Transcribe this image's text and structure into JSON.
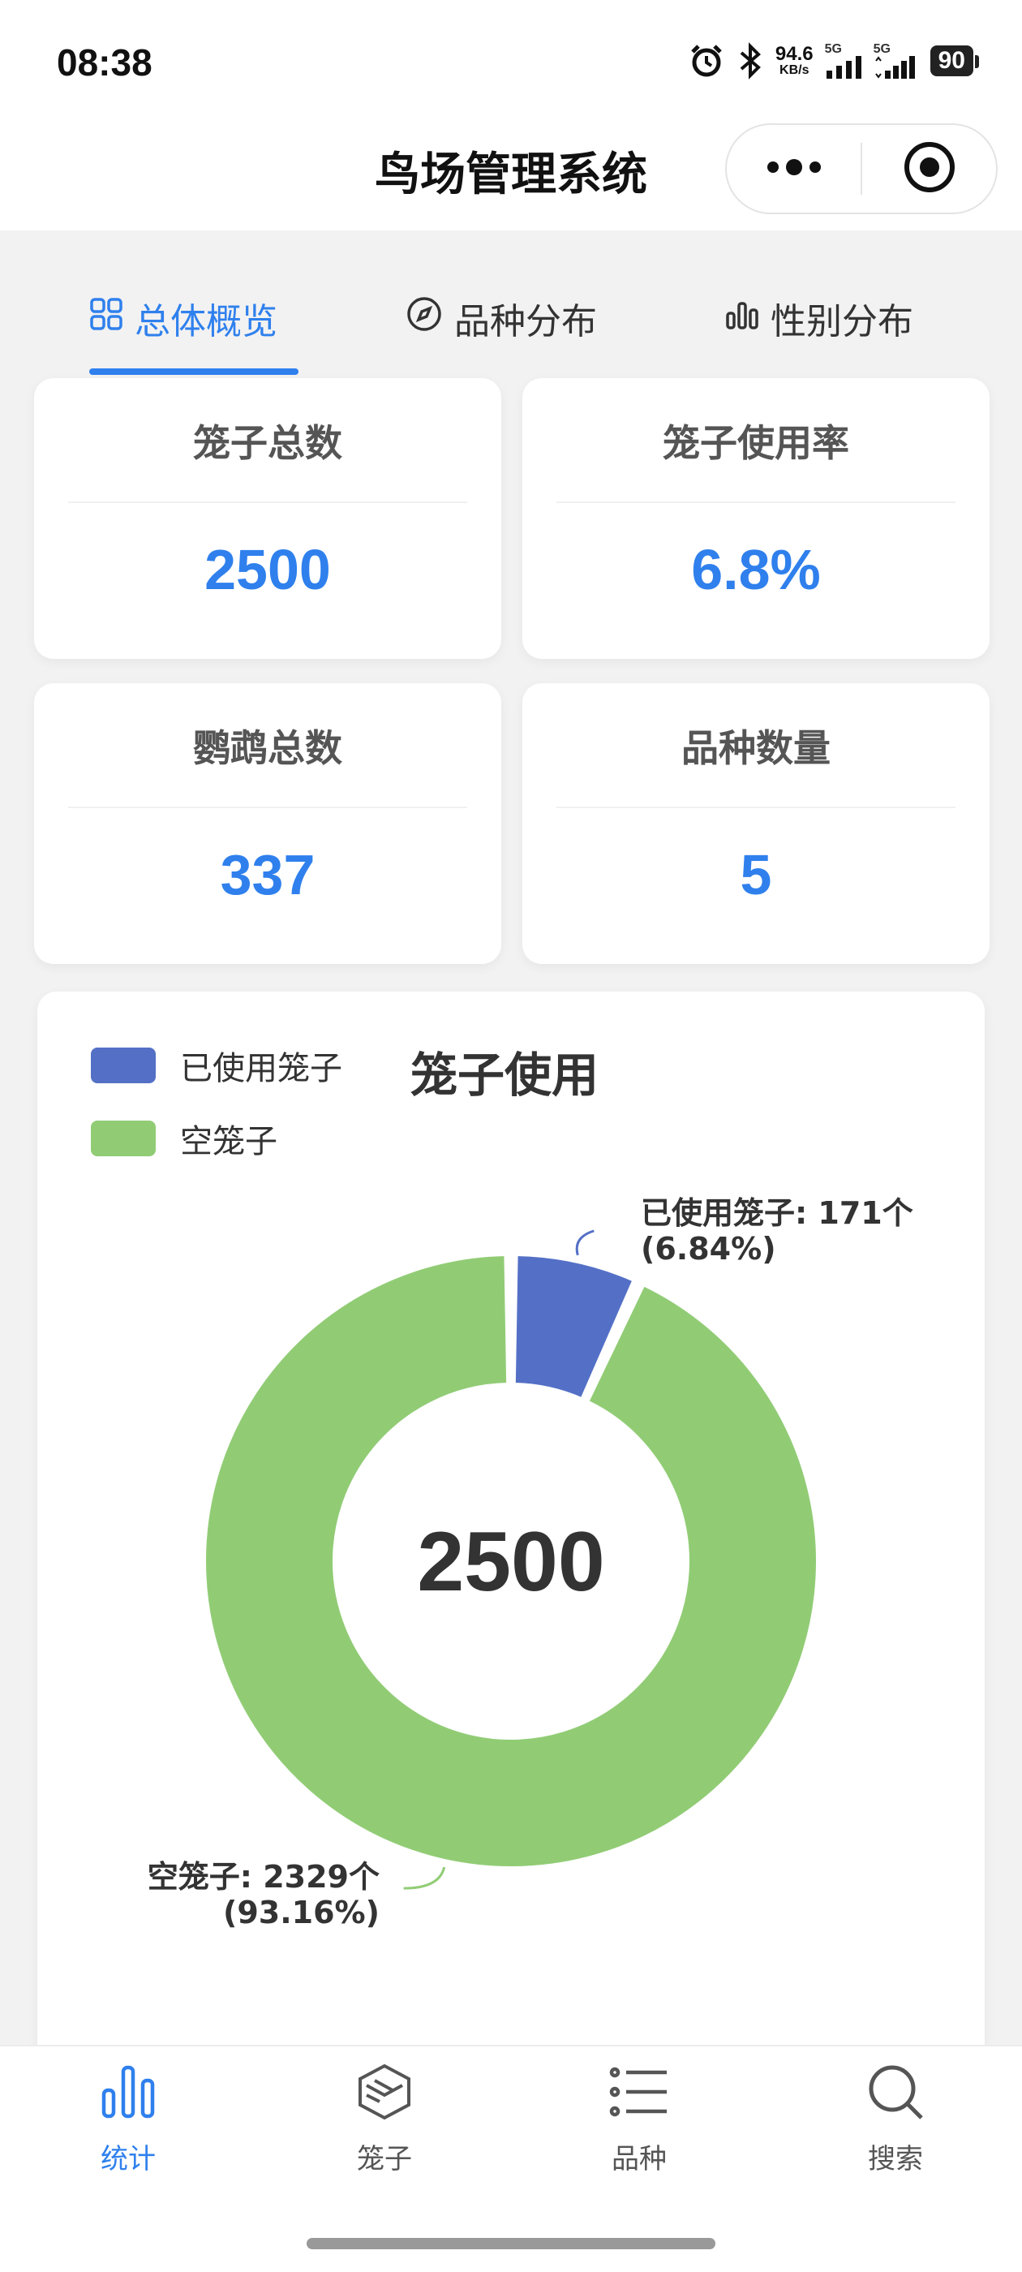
{
  "status_bar": {
    "time": "08:38",
    "net_speed_value": "94.6",
    "net_speed_unit": "KB/s",
    "signal1": "5G",
    "signal2": "5G",
    "battery": "90"
  },
  "nav": {
    "title": "鸟场管理系统"
  },
  "tabs": [
    {
      "label": "总体概览",
      "icon": "grid-icon",
      "active": true
    },
    {
      "label": "品种分布",
      "icon": "compass-icon",
      "active": false
    },
    {
      "label": "性别分布",
      "icon": "bar-chart-icon",
      "active": false
    }
  ],
  "stats": [
    {
      "title": "笼子总数",
      "value": "2500"
    },
    {
      "title": "笼子使用率",
      "value": "6.8%"
    },
    {
      "title": "鹦鹉总数",
      "value": "337"
    },
    {
      "title": "品种数量",
      "value": "5"
    }
  ],
  "colors": {
    "accent": "#2f80ed",
    "used": "#5470c6",
    "empty": "#91cc75"
  },
  "chart_data": {
    "type": "pie",
    "title": "笼子使用",
    "center_label": "2500",
    "legend": [
      "已使用笼子",
      "空笼子"
    ],
    "slices": [
      {
        "name": "已使用笼子",
        "value": 171,
        "percent": 6.84,
        "label_line1": "已使用笼子: 171个",
        "label_line2": "(6.84%)"
      },
      {
        "name": "空笼子",
        "value": 2329,
        "percent": 93.16,
        "label_line1": "空笼子: 2329个",
        "label_line2": "(93.16%)"
      }
    ]
  },
  "bottom_nav": [
    {
      "label": "统计",
      "icon": "bar-chart-icon",
      "active": true
    },
    {
      "label": "笼子",
      "icon": "cube-icon",
      "active": false
    },
    {
      "label": "品种",
      "icon": "list-icon",
      "active": false
    },
    {
      "label": "搜索",
      "icon": "search-icon",
      "active": false
    }
  ]
}
